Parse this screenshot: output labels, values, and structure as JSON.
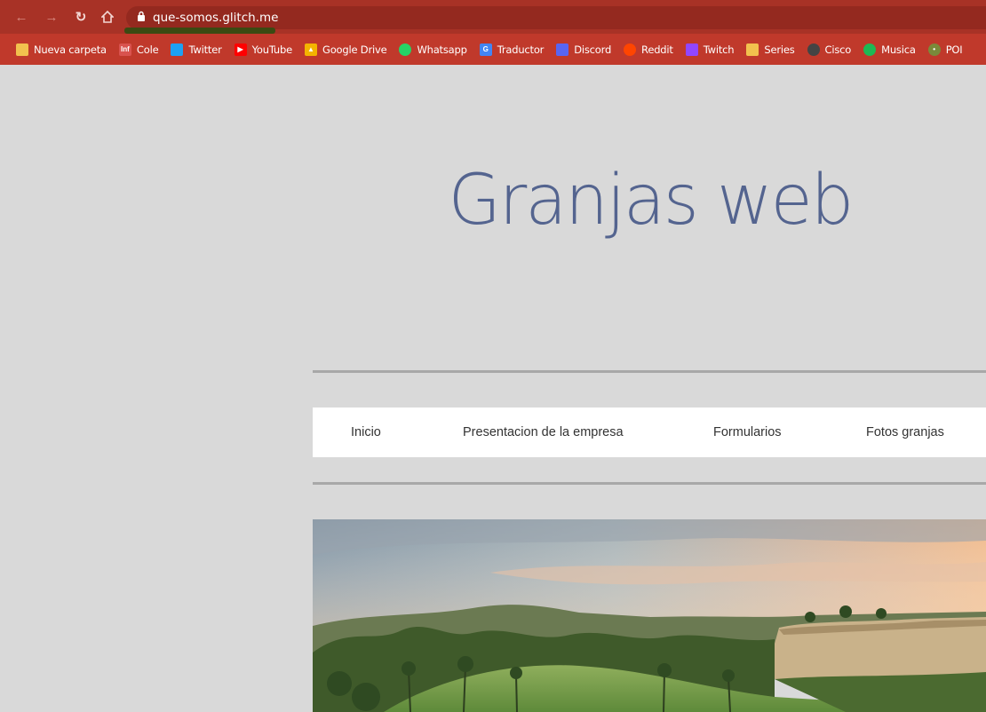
{
  "browser": {
    "url": "que-somos.glitch.me",
    "bookmarks": [
      {
        "label": "Nueva carpeta",
        "icon": "folder-icon",
        "color": "#f2c14e"
      },
      {
        "label": "Cole",
        "icon": "inf-icon",
        "color": "#d9534f"
      },
      {
        "label": "Twitter",
        "icon": "twitter-icon",
        "color": "#1da1f2"
      },
      {
        "label": "YouTube",
        "icon": "youtube-icon",
        "color": "#ff0000"
      },
      {
        "label": "Google Drive",
        "icon": "drive-icon",
        "color": "#f4b400"
      },
      {
        "label": "Whatsapp",
        "icon": "whatsapp-icon",
        "color": "#25d366"
      },
      {
        "label": "Traductor",
        "icon": "translate-icon",
        "color": "#4285f4"
      },
      {
        "label": "Discord",
        "icon": "discord-icon",
        "color": "#5865f2"
      },
      {
        "label": "Reddit",
        "icon": "reddit-icon",
        "color": "#ff4500"
      },
      {
        "label": "Twitch",
        "icon": "twitch-icon",
        "color": "#9146ff"
      },
      {
        "label": "Series",
        "icon": "folder-icon",
        "color": "#f2c14e"
      },
      {
        "label": "Cisco",
        "icon": "globe-icon",
        "color": "#444444"
      },
      {
        "label": "Musica",
        "icon": "spotify-icon",
        "color": "#1db954"
      },
      {
        "label": "POI",
        "icon": "poi-icon",
        "color": "#7a8a3a"
      }
    ]
  },
  "site": {
    "title": "Granjas web",
    "menu": [
      "Inicio",
      "Presentacion de la empresa",
      "Formularios",
      "Fotos granjas"
    ],
    "hero_image": "golf-landscape-image"
  },
  "colors": {
    "toolbar": "#a83226",
    "bookmarks_bar": "#c0392b",
    "page_bg": "#d9d9d9",
    "title": "#54648f"
  }
}
